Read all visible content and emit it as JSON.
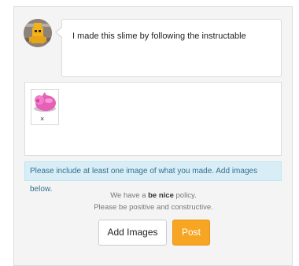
{
  "comment": {
    "avatar_icon": "robot-avatar-icon",
    "text": "I made this slime by following the instructable"
  },
  "images": {
    "thumbnail_icon": "pink-pig-slime-image",
    "remove_label": "×"
  },
  "notice": {
    "text": "Please include at least one image of what you made. Add images below."
  },
  "policy": {
    "prefix": "We have a ",
    "emphasis": "be nice",
    "suffix": " policy.",
    "line2": "Please be positive and constructive."
  },
  "actions": {
    "add_images_label": "Add Images",
    "post_label": "Post"
  },
  "colors": {
    "post_button": "#f6a623",
    "notice_bg": "#d9edf7",
    "notice_text": "#31708f"
  }
}
